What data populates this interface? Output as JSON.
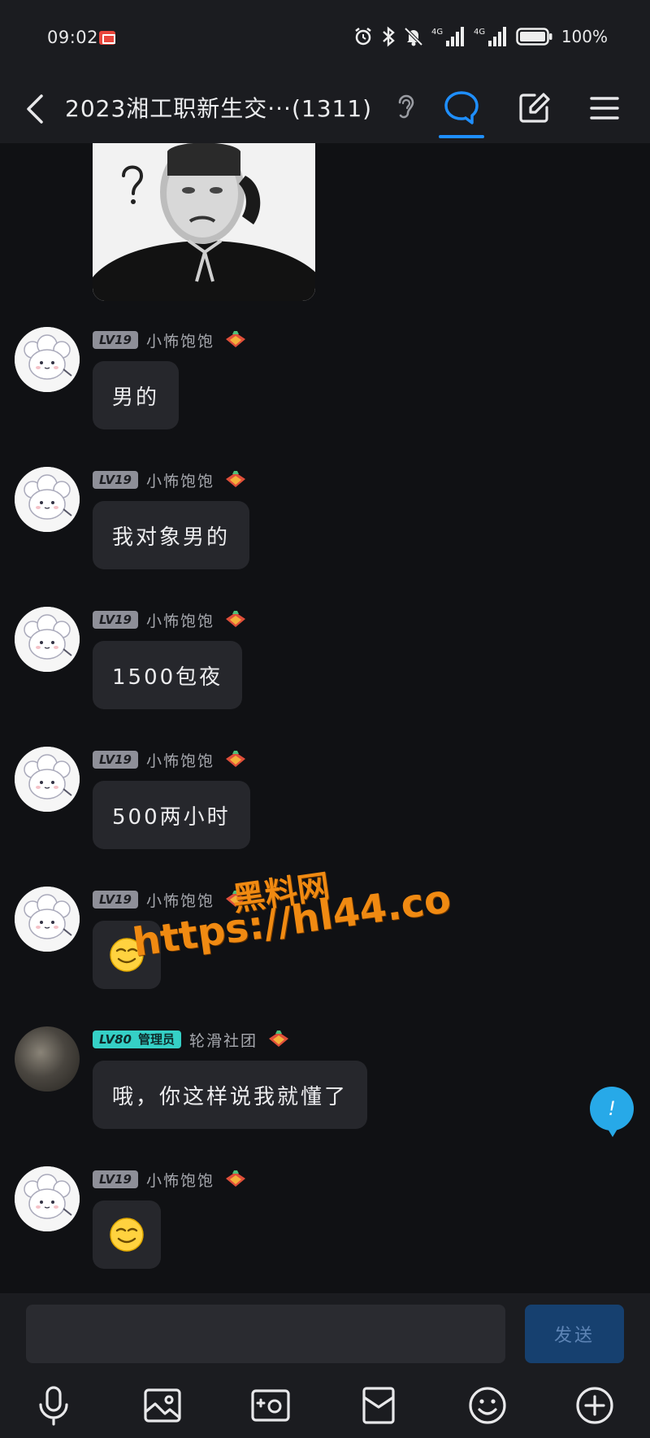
{
  "status_bar": {
    "time": "09:02",
    "battery": "100%",
    "icons": [
      "notification-icon",
      "alarm-icon",
      "bluetooth-icon",
      "mute-icon",
      "signal-4g-icon",
      "signal-4g-icon",
      "battery-icon"
    ]
  },
  "header": {
    "title": "2023湘工职新生交···(1311)",
    "icons": [
      "back-icon",
      "ear-icon",
      "chat-bubble-icon",
      "edit-icon",
      "menu-icon"
    ]
  },
  "messages": [
    {
      "level": "LV19",
      "nickname": "小怖饱饱",
      "text": "男的"
    },
    {
      "level": "LV19",
      "nickname": "小怖饱饱",
      "text": "我对象男的"
    },
    {
      "level": "LV19",
      "nickname": "小怖饱饱",
      "text": "1500包夜"
    },
    {
      "level": "LV19",
      "nickname": "小怖饱饱",
      "text": "500两小时"
    },
    {
      "level": "LV19",
      "nickname": "小怖饱饱",
      "emoji": "smirk-emoji"
    },
    {
      "level": "LV80",
      "role": "管理员",
      "nickname": "轮滑社团",
      "text": "哦，你这样说我就懂了"
    },
    {
      "level": "LV19",
      "nickname": "小怖饱饱",
      "emoji": "smirk-emoji"
    }
  ],
  "watermark": {
    "line1": "黑料网",
    "line2": "https://hl44.co"
  },
  "float_badge": "!",
  "input": {
    "value": "",
    "send_label": "发送"
  },
  "toolbar": [
    "microphone-icon",
    "image-icon",
    "camera-icon",
    "red-packet-icon",
    "emoji-icon",
    "plus-icon"
  ],
  "colors": {
    "background": "#101114",
    "bar": "#1b1c20",
    "bubble": "#26272c",
    "accent": "#1f8fff",
    "admin_badge": "#35d0c6",
    "watermark": "#f08a12"
  }
}
